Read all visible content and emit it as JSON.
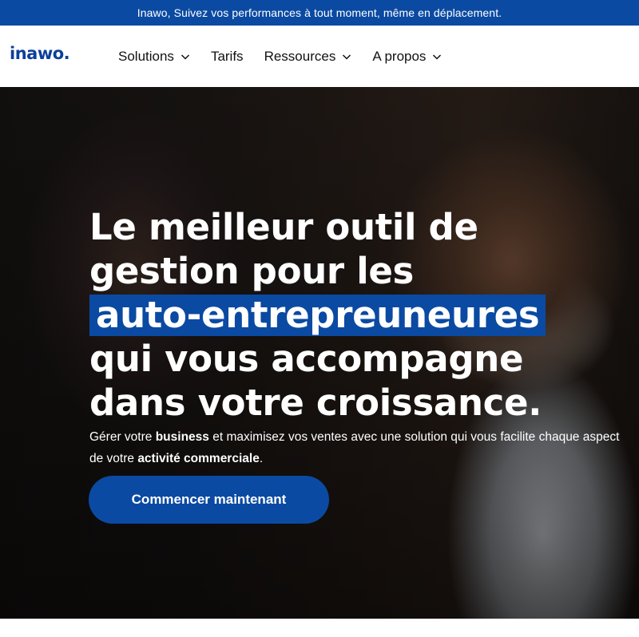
{
  "announcement": "Inawo, Suivez vos performances à tout moment, même en déplacement.",
  "brand": {
    "logo_text": "inawo."
  },
  "nav": {
    "items": [
      {
        "label": "Solutions",
        "has_dropdown": true
      },
      {
        "label": "Tarifs",
        "has_dropdown": false
      },
      {
        "label": "Ressources",
        "has_dropdown": true
      },
      {
        "label": "A propos",
        "has_dropdown": true
      }
    ]
  },
  "hero": {
    "headline_line1": "Le meilleur outil de",
    "headline_line2": "gestion pour les",
    "headline_highlight": "auto-entrepreuneures",
    "headline_line4": "qui vous accompagne",
    "headline_line5": "dans votre croissance.",
    "sub_part1": "Gérer votre ",
    "sub_bold1": "business",
    "sub_part2": " et maximisez vos ventes avec une solution qui vous facilite chaque aspect de votre ",
    "sub_bold2": "activité commerciale",
    "sub_part3": ".",
    "cta_label": "Commencer maintenant"
  },
  "colors": {
    "brand_blue": "#0b4aa2",
    "logo_blue": "#0b3f9a"
  }
}
